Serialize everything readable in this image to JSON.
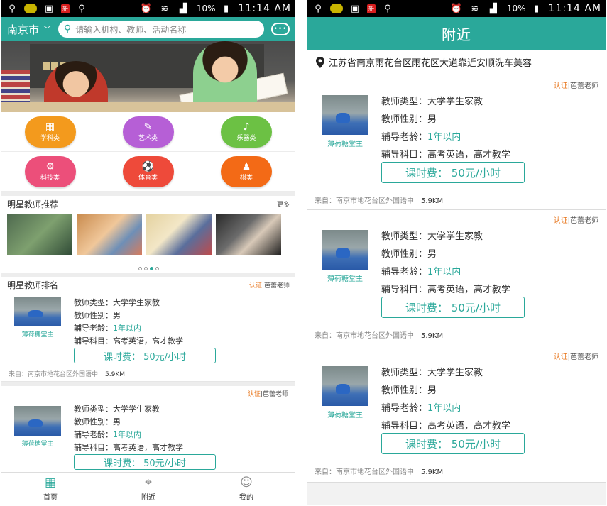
{
  "status": {
    "battery": "10%",
    "time": "11:14 AM",
    "tag": "新"
  },
  "left": {
    "city": "南京市",
    "search_placeholder": "请输入机构、教师、活动名称",
    "categories": [
      {
        "label": "学科类",
        "color": "#f39a1d",
        "glyph": "▦"
      },
      {
        "label": "艺术类",
        "color": "#b65fd6",
        "glyph": "✎"
      },
      {
        "label": "乐器类",
        "color": "#6cc144",
        "glyph": "♪"
      },
      {
        "label": "科技类",
        "color": "#ec4f7a",
        "glyph": "⚙"
      },
      {
        "label": "体育类",
        "color": "#ee4a3a",
        "glyph": "⚽"
      },
      {
        "label": "棋类",
        "color": "#f36a16",
        "glyph": "♟"
      }
    ],
    "star_recommend": {
      "title": "明星教师推荐",
      "more": "更多"
    },
    "star_rank": {
      "title": "明星教师排名",
      "cert": "认证",
      "cert_name": "芭蕾老师"
    },
    "nav": [
      {
        "label": "首页"
      },
      {
        "label": "附近"
      },
      {
        "label": "我的"
      }
    ]
  },
  "right": {
    "title": "附近",
    "location": "江苏省南京雨花台区雨花区大道靠近安顺洗车美容"
  },
  "card": {
    "name": "薄荷糖堂主",
    "type_label": "教师类型：",
    "type_value": "大学学生家教",
    "gender_label": "教师性别：",
    "gender_value": "男",
    "age_label": "辅导老龄：",
    "age_value": "1年以内",
    "subject_label": "辅导科目：",
    "subject_value": "高考英语，高才教学",
    "fee": "课时费：  50元/小时",
    "from": "来自：南京市地花台区外国语中",
    "distance": "5.9KM",
    "cert": "认证",
    "cert_name": "芭蕾老师"
  }
}
